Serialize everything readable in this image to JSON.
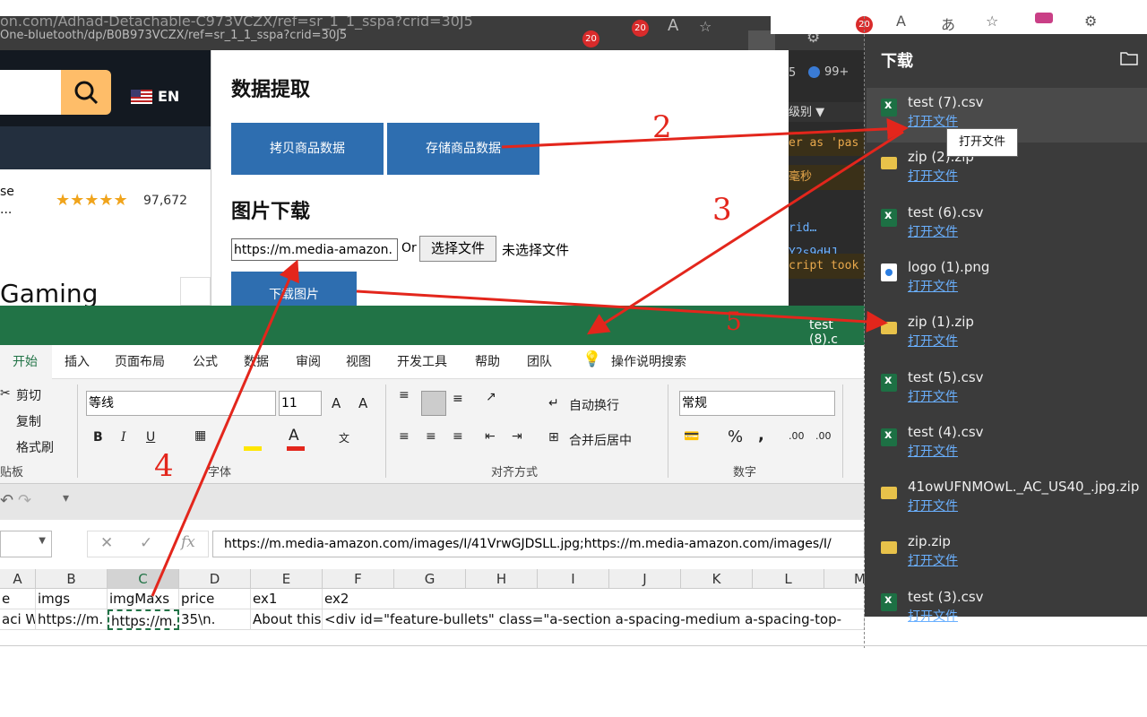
{
  "browser": {
    "url_line1": "on.com/Adhad-Detachable-C973VCZX/ref=sr_1_1_sspa?crid=30J5",
    "url_line2": "One-bluetooth/dp/B0B973VCZX/ref=sr_1_1_sspa?crid=30J5",
    "badge1": "20",
    "badge2": "20",
    "badge3": "20",
    "badge4": "20"
  },
  "amazon": {
    "lang": "EN",
    "product_snip": "se\n...",
    "rating_count": "97,672",
    "stars": 4.5,
    "title_snip": "Gaming"
  },
  "popup": {
    "section1_title": "数据提取",
    "btn_copy": "拷贝商品数据",
    "btn_save": "存储商品数据",
    "section2_title": "图片下载",
    "url_value": "https://m.media-amazon.",
    "or_text": "Or",
    "choose_file": "选择文件",
    "no_file": "未选择文件",
    "btn_download": "下载图片"
  },
  "devtools": {
    "counter1": "5",
    "counter2": "99+",
    "level": "级别",
    "lines": [
      "er as 'pas",
      "毫秒",
      "rid…Y2s9dHJ",
      "cript took"
    ]
  },
  "excel": {
    "title": "test (8).c",
    "tabs": [
      "开始",
      "插入",
      "页面布局",
      "公式",
      "数据",
      "审阅",
      "视图",
      "开发工具",
      "帮助",
      "团队",
      "操作说明搜索"
    ],
    "clipboard": {
      "cut": "剪切",
      "copy": "复制",
      "format_painter": "格式刷",
      "group": "贴板"
    },
    "font": {
      "name": "等线",
      "size": "11",
      "group": "字体"
    },
    "alignment": {
      "wrap": "自动换行",
      "merge": "合并后居中",
      "group": "对齐方式"
    },
    "number": {
      "format": "常规",
      "group": "数字"
    },
    "formula": "https://m.media-amazon.com/images/I/41VrwGJDSLL.jpg;https://m.media-amazon.com/images/I/",
    "columns": [
      "A",
      "B",
      "C",
      "D",
      "E",
      "F",
      "G",
      "H",
      "I",
      "J",
      "K",
      "L",
      "M"
    ],
    "row1": [
      "e",
      "imgs",
      "imgMaxs",
      "price",
      "ex1",
      "ex2"
    ],
    "row2": [
      "aci W",
      "https://m.",
      "https://m.",
      "35\\n.",
      "About this",
      "<div id=\"feature-bullets\" class=\"a-section a-spacing-medium a-spacing-top-"
    ]
  },
  "downloads": {
    "title": "下载",
    "open_label": "打开文件",
    "items": [
      {
        "name": "test (7).csv",
        "type": "csv"
      },
      {
        "name": "zip (2).zip",
        "type": "zip"
      },
      {
        "name": "test (6).csv",
        "type": "csv"
      },
      {
        "name": "logo (1).png",
        "type": "png"
      },
      {
        "name": "zip (1).zip",
        "type": "zip"
      },
      {
        "name": "test (5).csv",
        "type": "csv"
      },
      {
        "name": "test (4).csv",
        "type": "csv"
      },
      {
        "name": "41owUFNMOwL._AC_US40_.jpg.zip",
        "type": "zip"
      },
      {
        "name": "zip.zip",
        "type": "zip"
      },
      {
        "name": "test (3).csv",
        "type": "csv"
      }
    ],
    "tooltip": "打开文件"
  },
  "annotations": [
    "2",
    "3",
    "4",
    "5"
  ],
  "colors": {
    "excel_green": "#217346",
    "popup_button": "#2e6eb0",
    "arrow_red": "#e3261c",
    "download_panel": "#3b3b3b"
  }
}
